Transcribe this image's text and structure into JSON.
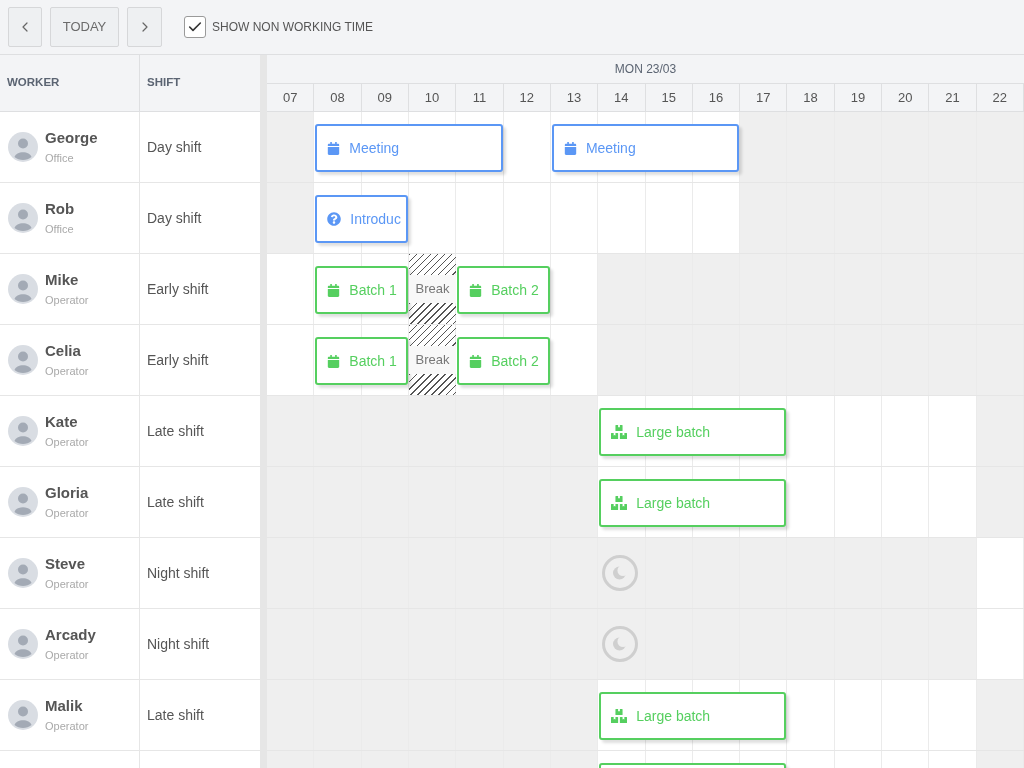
{
  "toolbar": {
    "today_button": "TODAY",
    "show_non_working_time": {
      "label": "SHOW NON WORKING TIME",
      "checked": true
    }
  },
  "grid_columns": [
    "WORKER",
    "SHIFT"
  ],
  "timeline": {
    "date": "MON 23/03",
    "hours": [
      "07",
      "08",
      "09",
      "10",
      "11",
      "12",
      "13",
      "14",
      "15",
      "16",
      "17",
      "18",
      "19",
      "20",
      "21",
      "22"
    ]
  },
  "rows": [
    {
      "worker": "George",
      "role": "Office",
      "shift": "Day shift",
      "schedule": {
        "kind": "day"
      },
      "events": [
        {
          "kind": "meeting",
          "label": "Meeting"
        },
        {
          "kind": "meeting",
          "label": "Meeting"
        }
      ]
    },
    {
      "worker": "Rob",
      "role": "Office",
      "shift": "Day shift",
      "schedule": {
        "kind": "day"
      },
      "events": [
        {
          "kind": "question",
          "label": "Introduc"
        }
      ]
    },
    {
      "worker": "Mike",
      "role": "Operator",
      "shift": "Early shift",
      "schedule": {
        "kind": "early"
      },
      "events": [
        {
          "kind": "batch",
          "label": "Batch 1"
        },
        {
          "kind": "break",
          "label": "Break"
        },
        {
          "kind": "batch",
          "label": "Batch 2"
        }
      ]
    },
    {
      "worker": "Celia",
      "role": "Operator",
      "shift": "Early shift",
      "schedule": {
        "kind": "early"
      },
      "events": [
        {
          "kind": "batch",
          "label": "Batch 1"
        },
        {
          "kind": "break",
          "label": "Break"
        },
        {
          "kind": "batch",
          "label": "Batch 2"
        }
      ]
    },
    {
      "worker": "Kate",
      "role": "Operator",
      "shift": "Late shift",
      "schedule": {
        "kind": "late"
      },
      "events": [
        {
          "kind": "large_batch",
          "label": "Large batch"
        }
      ]
    },
    {
      "worker": "Gloria",
      "role": "Operator",
      "shift": "Late shift",
      "schedule": {
        "kind": "late"
      },
      "events": [
        {
          "kind": "large_batch",
          "label": "Large batch"
        }
      ]
    },
    {
      "worker": "Steve",
      "role": "Operator",
      "shift": "Night shift",
      "schedule": {
        "kind": "night"
      },
      "events": [
        {
          "kind": "night"
        }
      ]
    },
    {
      "worker": "Arcady",
      "role": "Operator",
      "shift": "Night shift",
      "schedule": {
        "kind": "night"
      },
      "events": [
        {
          "kind": "night"
        }
      ]
    },
    {
      "worker": "Malik",
      "role": "Operator",
      "shift": "Late shift",
      "schedule": {
        "kind": "late"
      },
      "events": [
        {
          "kind": "large_batch",
          "label": "Large batch"
        }
      ]
    },
    {
      "schedule": {
        "kind": "late"
      },
      "events": [
        {
          "kind": "large_batch"
        }
      ]
    }
  ]
}
